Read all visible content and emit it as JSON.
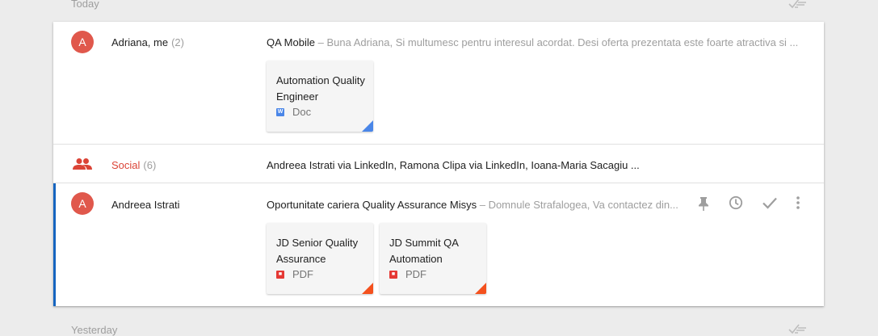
{
  "sections": {
    "today": "Today",
    "yesterday": "Yesterday"
  },
  "threads": [
    {
      "avatar_letter": "A",
      "sender": "Adriana, me",
      "count": "(2)",
      "subject": "QA Mobile",
      "snippet": " – Buna Adriana, Si multumesc pentru interesul acordat. Desi oferta prezentata este foarte atractiva si ...",
      "attachments": [
        {
          "title": "Automation Quality Engineer",
          "type": "Doc"
        }
      ]
    },
    {
      "label": "Social",
      "count": "(6)",
      "summary": "Andreea Istrati via LinkedIn, Ramona Clipa via LinkedIn, Ioana-Maria Sacagiu ..."
    },
    {
      "avatar_letter": "A",
      "sender": "Andreea Istrati",
      "subject": "Oportunitate cariera Quality Assurance Misys",
      "snippet": " – Domnule Strafalogea, Va contactez din...",
      "attachments": [
        {
          "title": "JD Senior Quality Assurance",
          "type": "PDF"
        },
        {
          "title": "JD Summit QA Automation",
          "type": "PDF"
        }
      ]
    }
  ],
  "colors": {
    "avatar": "#e0584c",
    "social": "#db4437",
    "doc_fold": "#4a86e8",
    "pdf_fold": "#f4511e",
    "active_bar": "#1565c0"
  },
  "icons": [
    "sweep-icon",
    "people-icon",
    "word-doc-icon",
    "pdf-icon",
    "pin-icon",
    "snooze-icon",
    "done-icon",
    "more-icon"
  ]
}
